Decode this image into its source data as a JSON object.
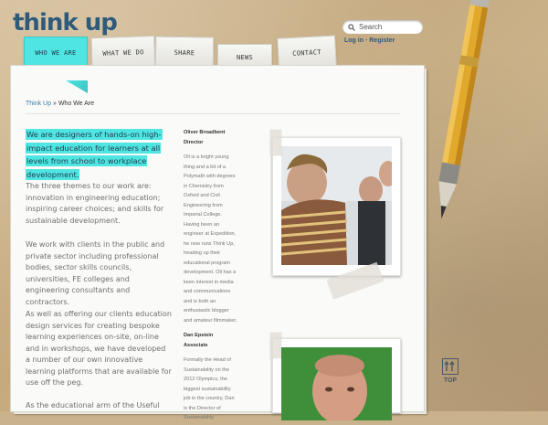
{
  "brand": {
    "logo": "think up"
  },
  "search": {
    "placeholder": "Search"
  },
  "auth": {
    "login": "Log in",
    "separator": "-",
    "register": "Register"
  },
  "nav": {
    "tabs": [
      {
        "label": "WHO WE ARE",
        "active": true
      },
      {
        "label": "WHAT WE DO"
      },
      {
        "label": "SHARE THOUGHTS"
      },
      {
        "label": "NEWS"
      },
      {
        "label": "CONTACT"
      }
    ]
  },
  "breadcrumb": {
    "home": "Think Up",
    "separator": "»",
    "current": "Who We Are"
  },
  "content": {
    "intro": "We are designers of hands-on high-impact education for learners at all levels from school to workplace development.",
    "paragraphs": [
      "The three themes to our work are: innovation in engineering education; inspiring career choices; and skills for sustainable development.",
      "We work with clients in the public and private sector including professional bodies, sector skills councils, universities, FE colleges and engineering consultants and contractors.",
      "As well as offering our clients education design services for creating bespoke learning experiences on-site, on-line and in workshops, we have developed a number of our own innovative learning platforms that are available for use off the peg.",
      "As the educational arm of the Useful"
    ]
  },
  "staff": [
    {
      "name": "Oliver Broadbent",
      "role": "Director",
      "bio": "Oli is a bright young thing and a bit of a Polymath with degrees in Chemistry from Oxford and Civil Engineering from Imperial College. Having been an engineer at Expedition, he now runs Think Up, heading up their educational program development. Oli has a keen interest in media and communications and is both an enthusiastic blogger and amateur filmmaker."
    },
    {
      "name": "Dan Epstein",
      "role": "Associate",
      "bio": "Formally the Head of Sustainability on the 2012 Olympics, the biggest sustainability job in the country, Dan is the Director of Sustainability"
    }
  ],
  "top_button": {
    "label": "TOP"
  },
  "colors": {
    "highlight": "#4fe5e3",
    "link": "#3d7fa5",
    "logo": "#2f5a7a"
  }
}
